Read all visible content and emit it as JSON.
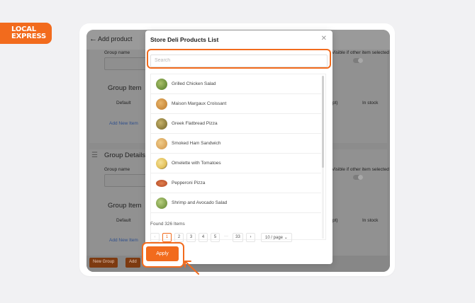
{
  "brand": {
    "logo_line1": "LOCAL",
    "logo_line2": "EXPRESS",
    "accent": "#f26b1d"
  },
  "background": {
    "back_icon": "arrow-left-icon",
    "page_title": "Add product",
    "card1": {
      "group_name_label": "Group name",
      "visible_label": "Visible if other item selected",
      "group_item": "Group Item",
      "default": "Default",
      "opt": "pt)",
      "in_stock": "In stock",
      "add_new_item": "Add New Item"
    },
    "card2": {
      "group_details": "Group Details",
      "group_name_label": "Group name",
      "visible_label": "Visible if other item selected",
      "group_item": "Group Item",
      "default": "Default",
      "opt": "pt)",
      "in_stock": "In stock",
      "add_new_item": "Add New Item"
    },
    "new_group_button": "New Group",
    "add_button": "Add"
  },
  "modal": {
    "title": "Store Deli Products List",
    "close_icon": "close-icon",
    "search_placeholder": "Search",
    "products": [
      {
        "name": "Grilled Chicken Salad",
        "color": "#6b8e3a"
      },
      {
        "name": "Maison Margaux Croissant",
        "color": "#c98a3c"
      },
      {
        "name": "Greek Flatbread Pizza",
        "color": "#8a7a3a"
      },
      {
        "name": "Smoked Ham Sandwich",
        "color": "#d9a45a"
      },
      {
        "name": "Omelette with Tomatoes",
        "color": "#e3c15a"
      },
      {
        "name": "Pepperoni Pizza",
        "color": "#c0582f"
      },
      {
        "name": "Shrimp and Avocado Salad",
        "color": "#7a9a45"
      }
    ],
    "found_text": "Found 326 Items",
    "pagination": {
      "prev": "‹",
      "pages": [
        "1",
        "2",
        "3",
        "4",
        "5"
      ],
      "ellipsis": "···",
      "last": "33",
      "next": "›",
      "active": "1",
      "per_page": "10 / page ⌄"
    },
    "apply_label": "Apply"
  }
}
